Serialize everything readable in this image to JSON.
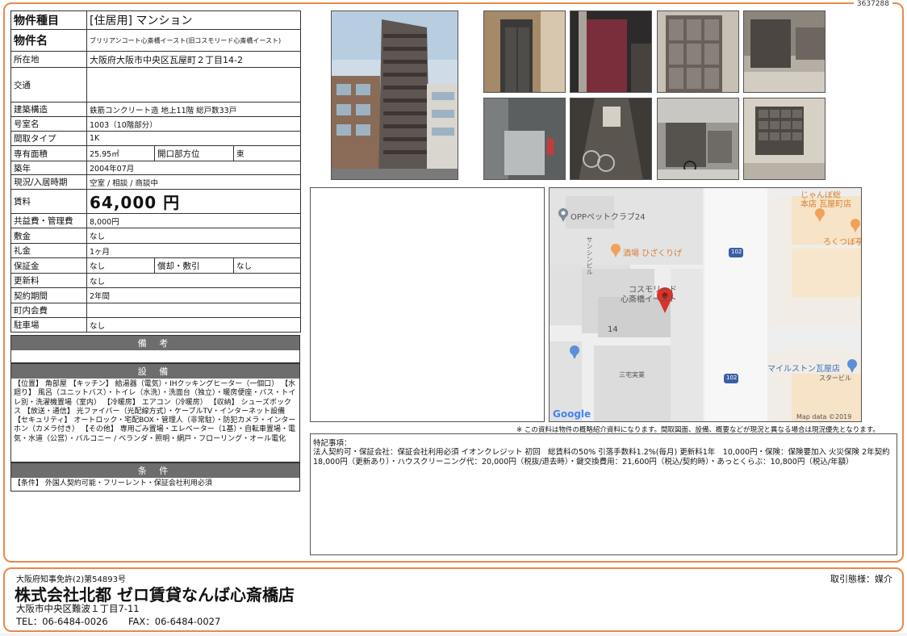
{
  "doc_id": "3637288",
  "property": {
    "type_label": "物件種目",
    "type_value": "[住居用] マンション",
    "name_label": "物件名",
    "name_value": "ブリリアンコート心斎橋イースト(旧コスモリード心斎橋イースト)",
    "location_label": "所在地",
    "location_value": "大阪府大阪市中央区瓦屋町２丁目14-2",
    "transport_label": "交通",
    "transport_value": "",
    "structure_label": "建築構造",
    "structure_value": "鉄筋コンクリート造 地上11階 総戸数33戸",
    "room_label": "号室名",
    "room_value": "1003（10階部分）",
    "layout_label": "間取タイプ",
    "layout_value": "1K",
    "area_label": "専有面積",
    "area_value": "25.95㎡",
    "opening_label": "開口部方位",
    "opening_value": "東",
    "built_label": "築年",
    "built_value": "2004年07月",
    "status_label": "現況/入居時期",
    "status_value": "空室 / 相談 / 商談中",
    "rent_label": "賃料",
    "rent_value": "64,000 円",
    "fee_label": "共益費・管理費",
    "fee_value": "8,000円",
    "deposit_label": "敷金",
    "deposit_value": "なし",
    "key_money_label": "礼金",
    "key_money_value": "1ヶ月",
    "guarantee_label": "保証金",
    "guarantee_value": "なし",
    "amort_label": "償却・敷引",
    "amort_value": "なし",
    "renewal_label": "更新料",
    "renewal_value": "なし",
    "contract_label": "契約期間",
    "contract_value": "2年間",
    "town_fee_label": "町内会費",
    "town_fee_value": "",
    "parking_label": "駐車場",
    "parking_value": "なし"
  },
  "sections": {
    "remarks_title": "備 考",
    "remarks_text": "",
    "equipment_title": "設 備",
    "equipment_text": "【位置】 角部屋 【キッチン】 給湯器（電気）・IHクッキングヒーター（一個口） 【水廻り】 風呂（ユニットバス）・トイレ（水洗）・洗面台（独立）・暖房便座・バス・トイレ別・洗濯機置場（室内） 【冷暖房】 エアコン（冷暖房） 【収納】 シューズボックス 【放送・通信】 光ファイバー（光配線方式）・ケーブルTV・インターネット設備 【セキュリティ】 オートロック・宅配BOX・管理人（非常駐）・防犯カメラ・インターホン（カメラ付き） 【その他】 専用ごみ置場・エレベーター（1基）・自転車置場・電気・水道（公営）・バルコニー / ベランダ・照明・網戸・フローリング・オール電化",
    "conditions_title": "条 件",
    "conditions_text": "【条件】 外国人契約可能・フリーレント・保証会社利用必須"
  },
  "map": {
    "labels": {
      "opp": "OPPペットクラブ24",
      "sanshin": "サンシンビル",
      "hizakurige": "酒場 ひざくりげ",
      "cosmo1": "コスモリード",
      "cosmo2": "心斎橋イースト",
      "block": "14",
      "jyanbo1": "じゃんぼ総",
      "jyanbo2": "本店 瓦屋町店",
      "rokutsubo": "ろくつぼ亭",
      "road1": "102",
      "road2": "102",
      "milestone": "マイルストン瓦屋店",
      "starbill": "スタービル",
      "sanwa": "三宅実業",
      "google": "Google",
      "copyright": "Map data ©2019"
    }
  },
  "disclaimer": "※ この資料は物件の概略紹介資料になります。間取図面、設備、概要などが現況と異なる場合は現況優先となります。",
  "special": {
    "title": "特記事項：",
    "body": "法人契約可・保証会社：保証会社利用必須 イオンクレジット 初回　総賃料の50% 引落手数料1.2%(毎月) 更新料1年　10,000円・保険：保険要加入 火災保険 2年契約 18,000円（更新あり）・ハウスクリーニング代：20,000円（税抜/退去時）・鍵交換費用：21,600円（税込/契約時）・あっとくらぶ：10,800円（税込/年額）"
  },
  "footer": {
    "license": "大阪府知事免許(2)第54893号",
    "company": "株式会社北都 ゼロ賃貸なんば心斎橋店",
    "address": "大阪市中央区難波１丁目7-11",
    "tel": "TEL：06-6484-0026",
    "fax": "FAX：06-6484-0027",
    "deal": "取引態様：媒介"
  },
  "colors": {
    "frame": "#e8894a",
    "section_header": "#6d6d6d",
    "map_pin": "#d9332a"
  }
}
